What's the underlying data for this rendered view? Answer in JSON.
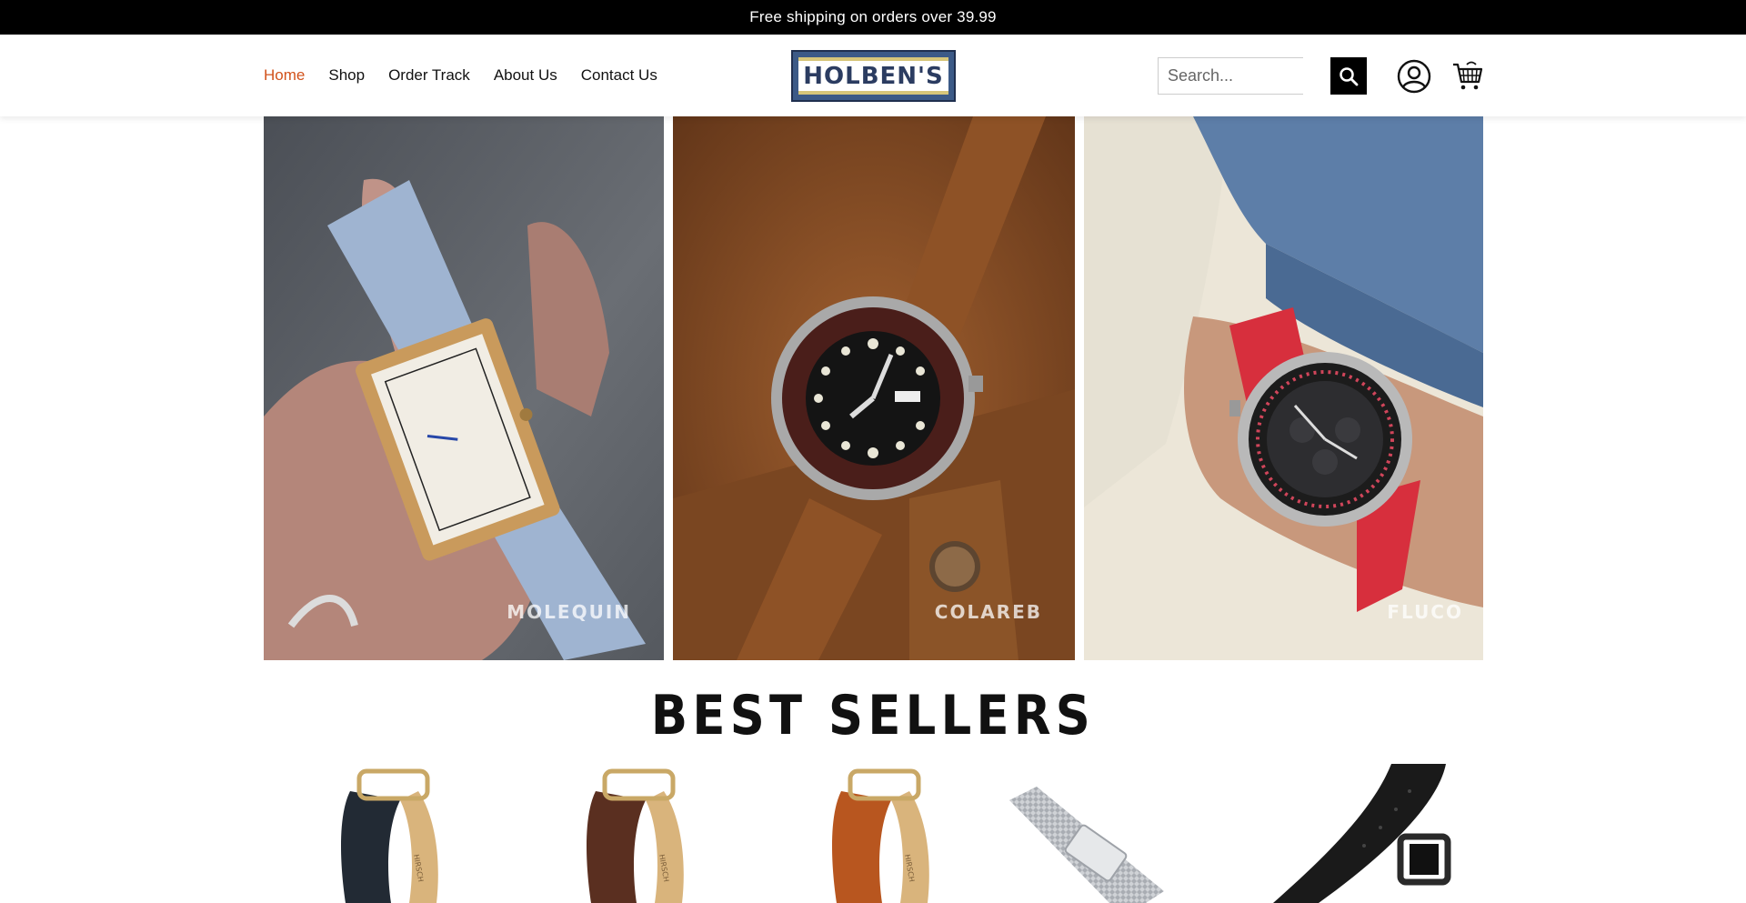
{
  "announcement": {
    "text": "Free shipping on orders over 39.99"
  },
  "nav": {
    "items": [
      {
        "label": "Home",
        "active": true
      },
      {
        "label": "Shop",
        "active": false
      },
      {
        "label": "Order Track",
        "active": false
      },
      {
        "label": "About Us",
        "active": false
      },
      {
        "label": "Contact Us",
        "active": false
      }
    ]
  },
  "logo": {
    "text": "HOLBEN'S"
  },
  "search": {
    "placeholder": "Search...",
    "value": ""
  },
  "icons": {
    "search": "search-icon",
    "account": "user-circle-icon",
    "cart": "cart-icon"
  },
  "hero": {
    "panels": [
      {
        "label": "MOLEQUIN"
      },
      {
        "label": "COLAREB"
      },
      {
        "label": "FLUCO"
      }
    ]
  },
  "best_sellers": {
    "title": "BEST SELLERS",
    "products": [
      {
        "image": "dark-navy-leather-strap"
      },
      {
        "image": "brown-leather-strap"
      },
      {
        "image": "tan-leather-strap"
      },
      {
        "image": "steel-mesh-bracelet"
      },
      {
        "image": "black-leather-strap"
      }
    ]
  },
  "colors": {
    "accent": "#d2521b",
    "topbar": "#000000",
    "logo_blue": "#3c5a87"
  }
}
